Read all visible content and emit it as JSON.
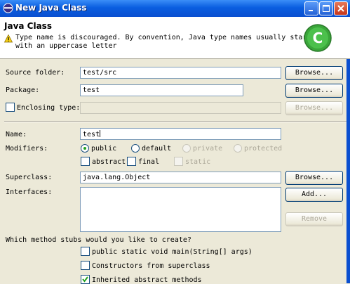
{
  "window": {
    "title": "New Java Class",
    "buttons": {
      "minimize": "minimize",
      "maximize": "maximize",
      "close": "close"
    }
  },
  "header": {
    "title": "Java Class",
    "message_line1": "Type name is discouraged. By convention, Java type names usually start",
    "message_line2": "with an uppercase letter",
    "warning_icon": "warning-icon",
    "logo_letter": "C"
  },
  "source_folder": {
    "label": "Source folder:",
    "value": "test/src",
    "browse": "Browse..."
  },
  "package": {
    "label": "Package:",
    "value": "test",
    "browse": "Browse..."
  },
  "enclosing_type": {
    "label": "Enclosing type:",
    "value": "",
    "browse": "Browse..."
  },
  "name": {
    "label": "Name:",
    "value": "test"
  },
  "modifiers": {
    "label": "Modifiers:",
    "public": "public",
    "default": "default",
    "private": "private",
    "protected": "protected",
    "abstract": "abstract",
    "final": "final",
    "static": "static",
    "selected": "public"
  },
  "superclass": {
    "label": "Superclass:",
    "value": "java.lang.Object",
    "browse": "Browse..."
  },
  "interfaces": {
    "label": "Interfaces:",
    "add": "Add...",
    "remove": "Remove"
  },
  "stubs": {
    "question": "Which method stubs would you like to create?",
    "main": "public static void main(String[] args)",
    "constructors": "Constructors from superclass",
    "inherited": "Inherited abstract methods",
    "inherited_checked": true
  },
  "colors": {
    "titlebar": "#0a5ee0",
    "dialog_bg": "#ece9d8",
    "logo": "#3aa63a"
  }
}
